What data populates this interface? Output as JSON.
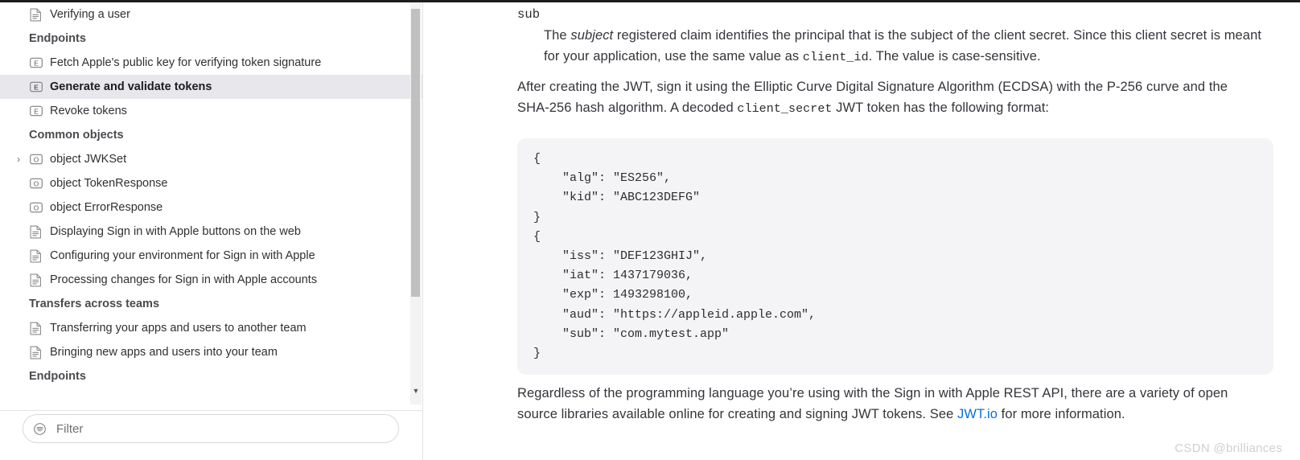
{
  "sidebar": {
    "nav_items": [
      {
        "label": "Verifying a user",
        "icon": "document-icon",
        "kind": "doc",
        "selected": false
      },
      {
        "label": "Endpoints",
        "kind": "section"
      },
      {
        "label": "Fetch Apple's public key for verifying token signature",
        "icon": "endpoint-icon",
        "kind": "endpoint",
        "selected": false
      },
      {
        "label": "Generate and validate tokens",
        "icon": "endpoint-icon",
        "kind": "endpoint",
        "selected": true
      },
      {
        "label": "Revoke tokens",
        "icon": "endpoint-icon",
        "kind": "endpoint",
        "selected": false
      },
      {
        "label": "Common objects",
        "kind": "section"
      },
      {
        "label": "object JWKSet",
        "icon": "object-icon",
        "kind": "object",
        "disclosure": "›",
        "selected": false
      },
      {
        "label": "object TokenResponse",
        "icon": "object-icon",
        "kind": "object",
        "selected": false
      },
      {
        "label": "object ErrorResponse",
        "icon": "object-icon",
        "kind": "object",
        "selected": false
      },
      {
        "label": "Displaying Sign in with Apple buttons on the web",
        "icon": "document-icon",
        "kind": "doc",
        "selected": false
      },
      {
        "label": "Configuring your environment for Sign in with Apple",
        "icon": "document-icon",
        "kind": "doc",
        "selected": false
      },
      {
        "label": "Processing changes for Sign in with Apple accounts",
        "icon": "document-icon",
        "kind": "doc",
        "selected": false
      },
      {
        "label": "Transfers across teams",
        "kind": "section"
      },
      {
        "label": "Transferring your apps and users to another team",
        "icon": "document-icon",
        "kind": "doc",
        "selected": false
      },
      {
        "label": "Bringing new apps and users into your team",
        "icon": "document-icon",
        "kind": "doc",
        "selected": false
      },
      {
        "label": "Endpoints",
        "kind": "section"
      }
    ],
    "filter": {
      "placeholder": "Filter",
      "value": "",
      "icon": "filter-icon"
    },
    "scrollbar": {
      "down_arrow": "▼"
    },
    "selected_background": "#e7e7ec"
  },
  "main": {
    "term": "sub",
    "definition": {
      "prefix": "The ",
      "italic": "subject",
      "middle": " registered claim identifies the principal that is the subject of the client secret. Since this client secret is meant for your application, use the same value as ",
      "code": "client_id",
      "suffix": ". The value is case-sensitive."
    },
    "paragraph1": {
      "part1": "After creating the JWT, sign it using the Elliptic Curve Digital Signature Algorithm (ECDSA) with the P-256 curve and the SHA-256 hash algorithm. A decoded ",
      "code": "client_secret",
      "part2": " JWT token has the following format:"
    },
    "code_block": "{\n    \"alg\": \"ES256\",\n    \"kid\": \"ABC123DEFG\"\n}\n{\n    \"iss\": \"DEF123GHIJ\",\n    \"iat\": 1437179036,\n    \"exp\": 1493298100,\n    \"aud\": \"https://appleid.apple.com\",\n    \"sub\": \"com.mytest.app\"\n}",
    "paragraph2": {
      "part1": "Regardless of the programming language you’re using with the Sign in with Apple REST API, there are a variety of open source libraries available online for creating and signing JWT tokens. See ",
      "link_text": "JWT.io",
      "part2": " for more information."
    },
    "link_color": "#0a6ed9"
  },
  "watermark": "CSDN @brilliances"
}
